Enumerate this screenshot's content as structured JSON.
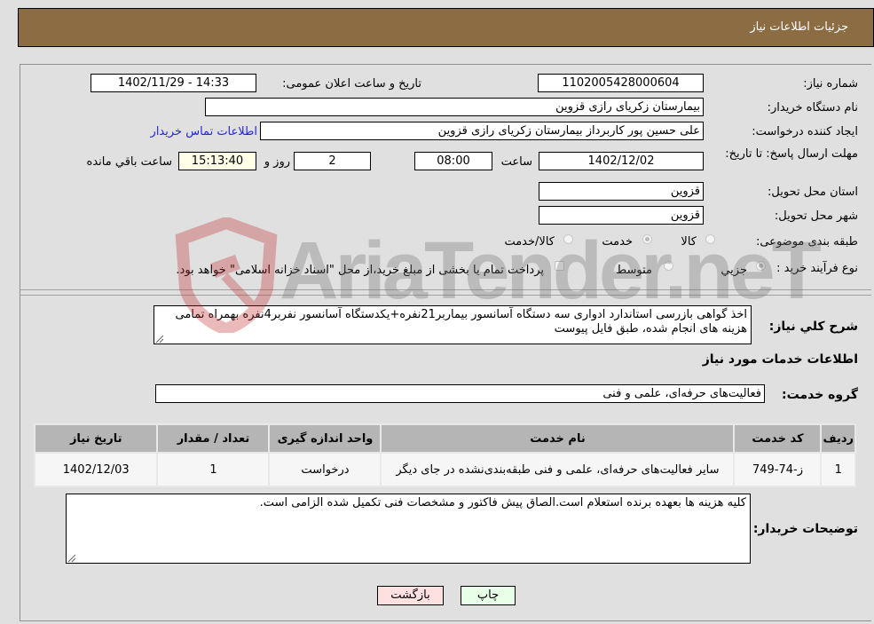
{
  "header": {
    "title": "جزئیات اطلاعات نیاز"
  },
  "fields": {
    "need_number_label": "شماره نیاز:",
    "need_number": "1102005428000604",
    "announce_label": "تاریخ و ساعت اعلان عمومی:",
    "announce_value": "1402/11/29 - 14:33",
    "buyer_org_label": "نام دستگاه خریدار:",
    "buyer_org": "بیمارستان زکریای رازی قزوین",
    "creator_label": "ایجاد کننده درخواست:",
    "creator": "علی حسین پور کاربرداز بیمارستان زکریای رازی قزوین",
    "contact_link": "اطلاعات تماس خریدار",
    "deadline_label": "مهلت ارسال پاسخ: تا تاریخ:",
    "deadline_date": "1402/12/02",
    "time_label": "ساعت",
    "deadline_time": "08:00",
    "days_value": "2",
    "days_label": "روز و",
    "remaining_time": "15:13:40",
    "remaining_label": "ساعت باقي مانده",
    "province_label": "استان محل تحویل:",
    "province": "قزوین",
    "city_label": "شهر محل تحویل:",
    "city": "قزوین",
    "category_label": "طبقه بندی موضوعی:",
    "category_options": [
      {
        "label": "کالا",
        "checked": false
      },
      {
        "label": "خدمت",
        "checked": true
      },
      {
        "label": "کالا/خدمت",
        "checked": false
      }
    ],
    "process_label": "نوع فرآیند خرید :",
    "process_options": [
      {
        "label": "جزيي",
        "checked": true
      },
      {
        "label": "متوسط",
        "checked": false
      }
    ],
    "treasury_note": "پرداخت تمام یا بخشی از مبلغ خرید،از محل \"اسناد خزانه اسلامی\" خواهد بود."
  },
  "description": {
    "label": "شرح كلي نياز:",
    "text": "اخذ گواهی بازرسی استاندارد ادواری سه دستگاه آسانسور بیماربر21نفره+یکدستگاه آسانسور نفربر4نفره بهمراه تمامی هزینه های انجام شده، طبق فایل پیوست"
  },
  "services": {
    "section_title": "اطلاعات خدمات مورد نیاز",
    "group_label": "گروه خدمت:",
    "group_value": "فعالیت‌های حرفه‌ای، علمی و فنی",
    "table": {
      "headers": [
        "ردیف",
        "کد خدمت",
        "نام خدمت",
        "واحد اندازه گیری",
        "تعداد / مقدار",
        "تاریخ نیاز"
      ],
      "rows": [
        [
          "1",
          "ز-74-749",
          "سایر فعالیت‌های حرفه‌ای، علمی و فنی طبقه‌بندی‌نشده در جای دیگر",
          "درخواست",
          "1",
          "1402/12/03"
        ]
      ]
    }
  },
  "buyer_notes": {
    "label": "توضیحات خریدار:",
    "text": "کلیه هزینه ها بعهده برنده استعلام است.الصاق پیش فاکتور و مشخصات فنی تکمیل شده الزامی است."
  },
  "buttons": {
    "print": "چاپ",
    "back": "بازگشت"
  },
  "watermark": {
    "text": "AriaTender.neT"
  },
  "colors": {
    "header_bg": "#8c6d43",
    "back_button_bg": "#ffe0e0",
    "print_button_bg": "#e8ffe8",
    "link": "#2222ee"
  }
}
